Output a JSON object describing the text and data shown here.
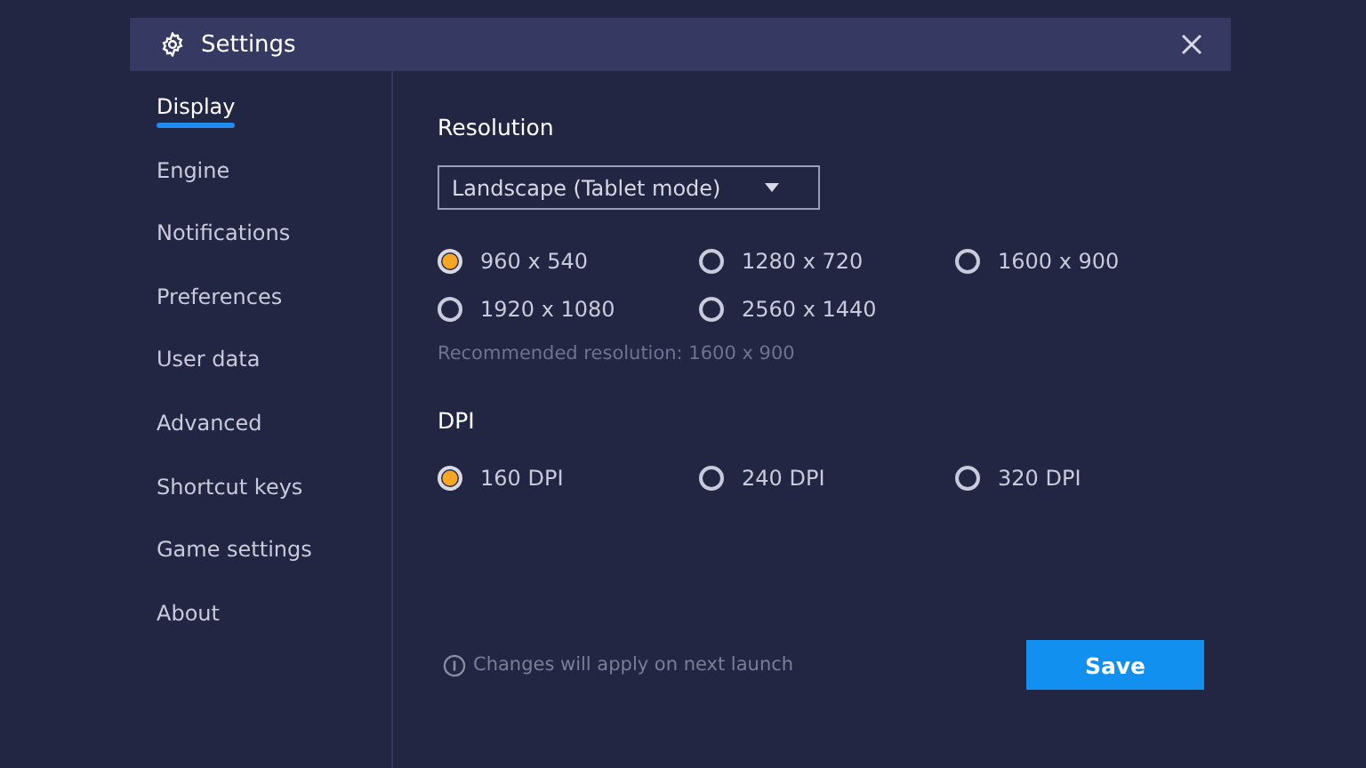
{
  "window": {
    "title": "Settings"
  },
  "sidebar": {
    "items": [
      {
        "label": "Display",
        "selected": true
      },
      {
        "label": "Engine",
        "selected": false
      },
      {
        "label": "Notifications",
        "selected": false
      },
      {
        "label": "Preferences",
        "selected": false
      },
      {
        "label": "User data",
        "selected": false
      },
      {
        "label": "Advanced",
        "selected": false
      },
      {
        "label": "Shortcut keys",
        "selected": false
      },
      {
        "label": "Game settings",
        "selected": false
      },
      {
        "label": "About",
        "selected": false
      }
    ]
  },
  "resolution": {
    "heading": "Resolution",
    "dropdown": {
      "value": "Landscape (Tablet mode)"
    },
    "options": [
      {
        "label": "960 x 540",
        "selected": true
      },
      {
        "label": "1280 x 720",
        "selected": false
      },
      {
        "label": "1600 x 900",
        "selected": false
      },
      {
        "label": "1920 x 1080",
        "selected": false
      },
      {
        "label": "2560 x 1440",
        "selected": false
      }
    ],
    "hint": "Recommended resolution: 1600 x 900"
  },
  "dpi": {
    "heading": "DPI",
    "options": [
      {
        "label": "160 DPI",
        "selected": true
      },
      {
        "label": "240 DPI",
        "selected": false
      },
      {
        "label": "320 DPI",
        "selected": false
      }
    ]
  },
  "footer": {
    "note": "Changes will apply on next launch",
    "save_button": "Save"
  }
}
